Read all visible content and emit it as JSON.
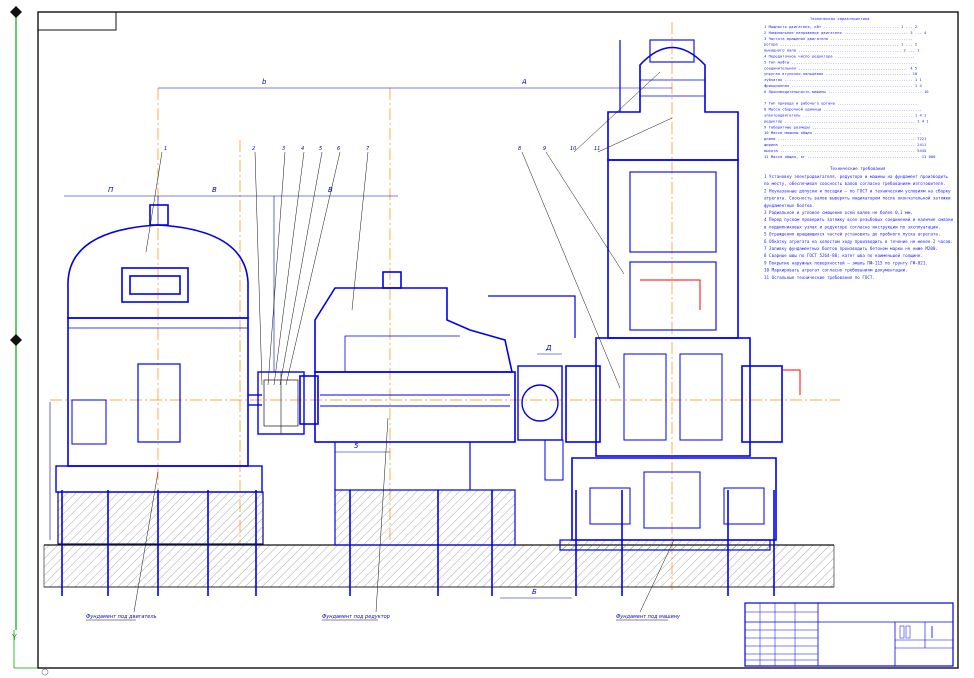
{
  "drawing": {
    "title_block": {
      "sheet_cells": [
        "",
        "",
        "",
        ""
      ]
    },
    "spec_table": {
      "heading": "Техническая характеристика",
      "rows": [
        "1 Мощность двигателя, кВт ................................. 1 ... 2",
        "2 Номинальное напряжение двигателя ............................ 3 ... 4",
        "3 Частота вращения двигателя ....................................",
        "   ротора .................................................... 1 ... 2",
        "   выходного вала ............................................. 2 ... 1",
        "4 Передаточное число редуктора ...................................",
        "5 Тип муфты .......................................................",
        "   соединительная ................................................ 4 5",
        "   упругая втулочно-пальцевая ..................................... 10",
        "   зубчатая ........................................................ 1 1",
        "   фрикционная ..................................................... 1 4",
        "6 Производительность машины ......................................... 10",
        "",
        "7 Тип привода и рабочего органа ...................................",
        "8 Масса сборочной единицы ...........................................",
        "   электродвигатель ................................................ 1 4 1",
        "   редуктор ......................................................... 1 4 1",
        "9 Габаритные размеры ..............................................",
        "10 Масса машины общая ...............................................",
        "   длина ............................................................ 7221",
        "   ширина ........................................................... 2411",
        "   высота ........................................................... 5445",
        "11 Масса общая, кг ................................................. 13 000"
      ]
    },
    "notes": {
      "heading": "Технические требования",
      "lines": [
        "1 Установку электродвигателя, редуктора и машины на фундамент производить",
        "  по месту, обеспечивая соосность валов согласно требованиям изготовителя.",
        "2 Неуказанные допуски и посадки — по ГОСТ и техническим условиям на сборку",
        "  агрегата. Соосность валов выверять индикатором после окончательной затяжки",
        "  фундаментных болтов.",
        "3 Радиальное и угловое смещение осей валов не более 0,1 мм.",
        "4 Перед пуском проверить затяжку всех резьбовых соединений и наличие смазки",
        "  в подшипниковых узлах и редукторе согласно инструкции по эксплуатации.",
        "5 Ограждения вращающихся частей установить до пробного пуска агрегата.",
        "6 Обкатку агрегата на холостом ходу производить в течение не менее 2 часов.",
        "7 Заливку фундаментных болтов производить бетоном марки не ниже М200.",
        "8 Сварные швы по ГОСТ 5264-80; катет шва по наименьшей толщине.",
        "9 Покрытие наружных поверхностей — эмаль ПФ-115 по грунту ГФ-021.",
        "10 Маркировать агрегат согласно требованиям документации.",
        "11 Остальные технические требования по ГОСТ."
      ]
    },
    "dimensions": {
      "overall_left": "b",
      "overall_right": "А",
      "motor_span": "В",
      "coupling_span": "П",
      "reducer_span": "В",
      "base_gap": "5",
      "right_base": "Б",
      "coupling_gap": "Д"
    },
    "leaders": {
      "motor_label": "1",
      "coupling_labels": [
        "2",
        "3",
        "4",
        "5",
        "6"
      ],
      "reducer_label": "7",
      "machine_labels": [
        "8",
        "9",
        "10",
        "11"
      ]
    },
    "foundation_labels": {
      "left": "Фундамент под двигатель",
      "middle": "Фундамент под редуктор",
      "right": "Фундамент под машину"
    },
    "colors": {
      "ink": "#0000ee",
      "dim": "#0000cc",
      "axis": "#ff8c00",
      "accent_red": "#ff0000",
      "border": "#111111",
      "green_edge": "#00aa00"
    }
  }
}
